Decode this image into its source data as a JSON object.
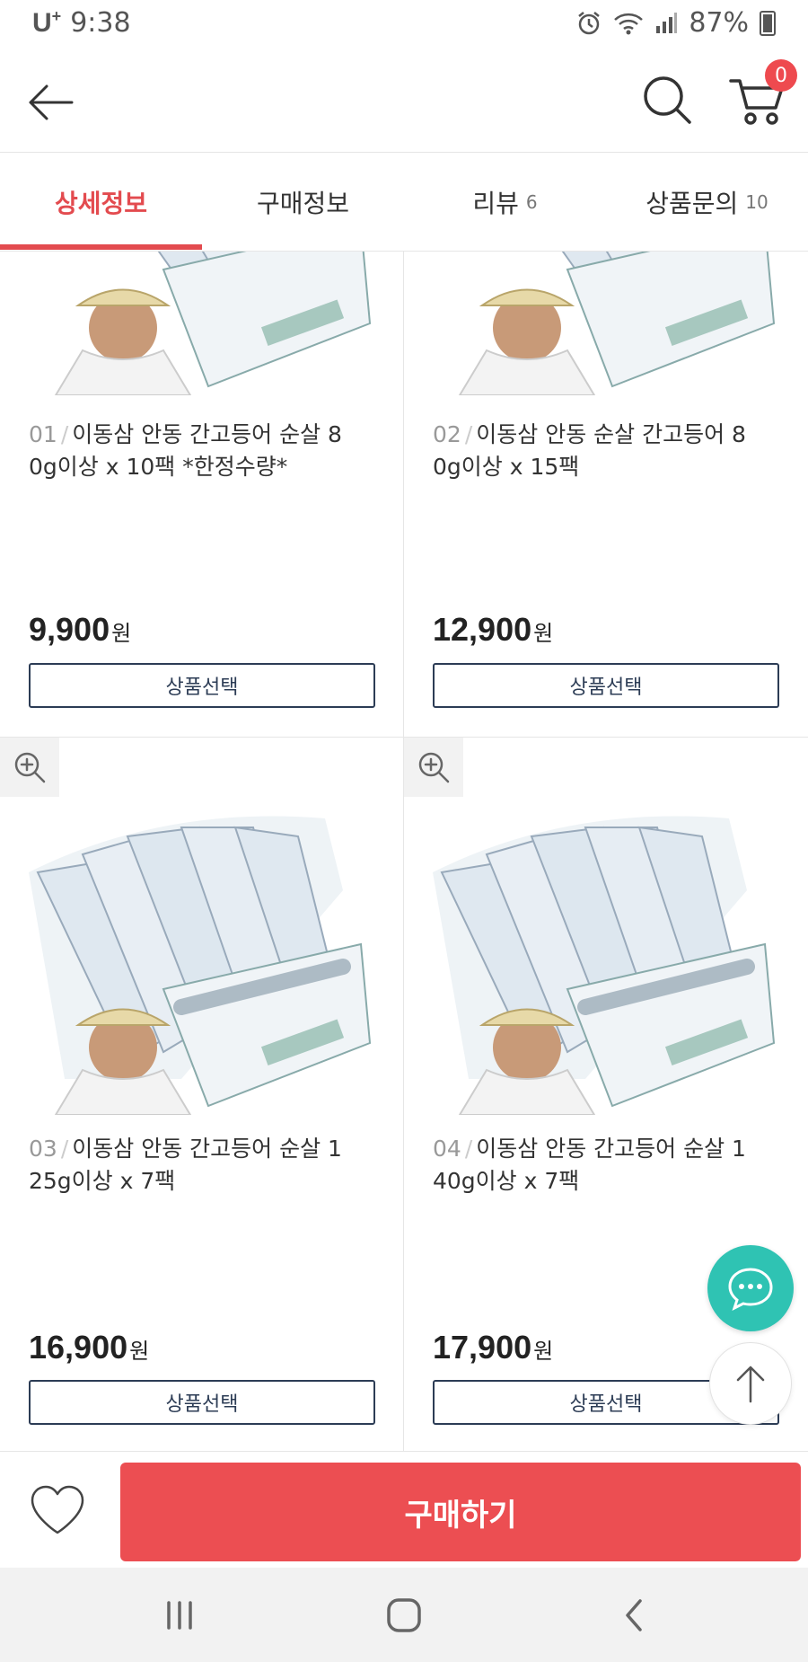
{
  "status_bar": {
    "carrier": "U",
    "carrier_plus": "+",
    "time": "9:38",
    "battery": "87%"
  },
  "header": {
    "back_icon": "arrow-left-icon",
    "search_icon": "search-icon",
    "cart_icon": "cart-icon",
    "cart_count": "0"
  },
  "tabs": [
    {
      "label": "상세정보",
      "count": "",
      "active": true
    },
    {
      "label": "구매정보",
      "count": "",
      "active": false
    },
    {
      "label": "리뷰",
      "count": "6",
      "active": false
    },
    {
      "label": "상품문의",
      "count": "10",
      "active": false
    }
  ],
  "products": [
    {
      "num": "01",
      "title_line1": "이동삼 안동 간고등어 순살 8",
      "title_line2": "0g이상 x 10팩 *한정수량*",
      "price": "9,900",
      "currency": "원",
      "button": "상품선택"
    },
    {
      "num": "02",
      "title_line1": "이동삼 안동 순살 간고등어 8",
      "title_line2": "0g이상 x 15팩",
      "price": "12,900",
      "currency": "원",
      "button": "상품선택"
    },
    {
      "num": "03",
      "title_line1": "이동삼 안동 간고등어 순살 1",
      "title_line2": "25g이상 x 7팩",
      "price": "16,900",
      "currency": "원",
      "button": "상품선택"
    },
    {
      "num": "04",
      "title_line1": "이동삼 안동 간고등어 순살 1",
      "title_line2": "40g이상 x 7팩",
      "price": "17,900",
      "currency": "원",
      "button": "상품선택"
    }
  ],
  "floating": {
    "chat_icon": "chat-bubble-icon",
    "top_icon": "arrow-up-icon"
  },
  "bottom_bar": {
    "heart_icon": "heart-icon",
    "buy_label": "구매하기"
  },
  "colors": {
    "accent": "#e34b4f",
    "buy": "#ec4e52",
    "chat": "#2fc3b3",
    "button_border": "#2c3c55"
  }
}
